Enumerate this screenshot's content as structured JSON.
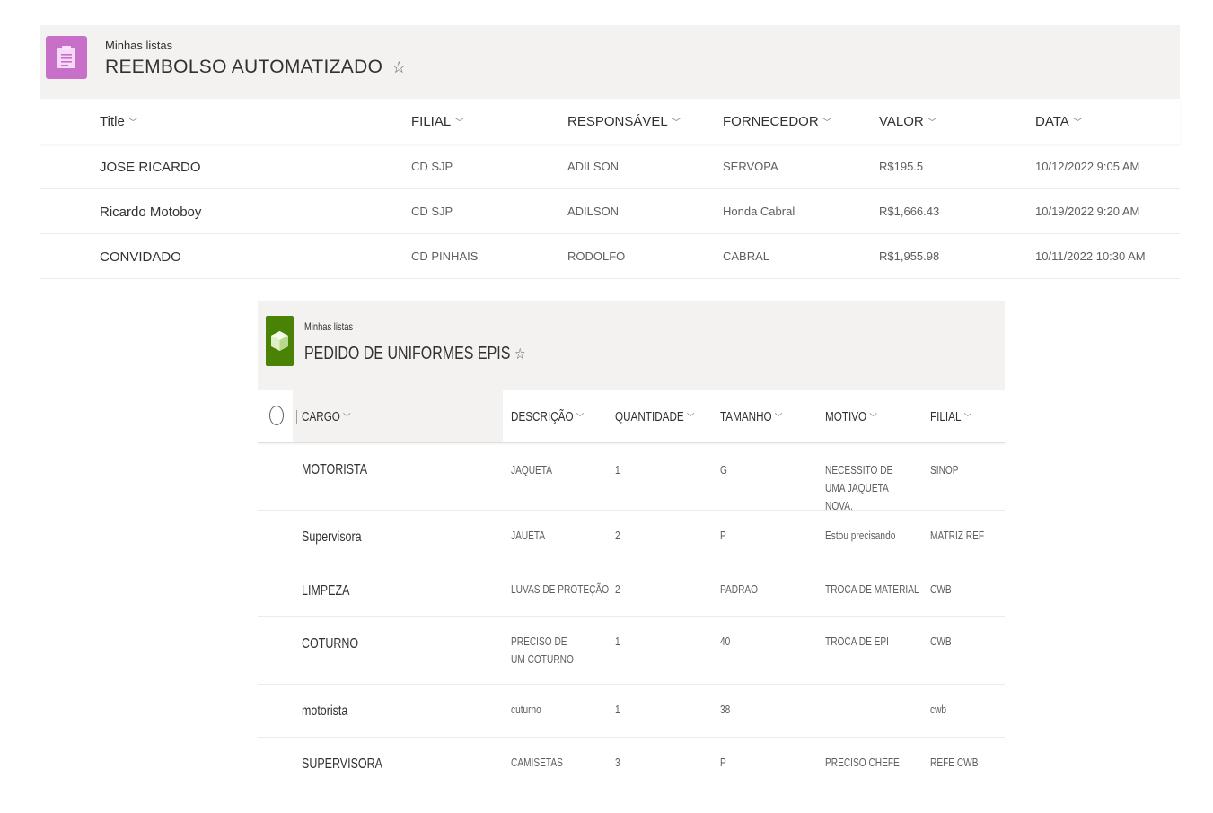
{
  "list1": {
    "breadcrumb": "Minhas listas",
    "title": "REEMBOLSO AUTOMATIZADO",
    "star": "☆",
    "icon_color": "#c86fc9",
    "columns": [
      "Title",
      "FILIAL",
      "RESPONSÁVEL",
      "FORNECEDOR",
      "VALOR",
      "DATA"
    ],
    "rows": [
      [
        "JOSE RICARDO",
        "CD SJP",
        "ADILSON",
        "SERVOPA",
        "R$195.5",
        "10/12/2022 9:05 AM"
      ],
      [
        "Ricardo Motoboy",
        "CD SJP",
        "ADILSON",
        "Honda Cabral",
        "R$1,666.43",
        "10/19/2022 9:20 AM"
      ],
      [
        "CONVIDADO",
        "CD PINHAIS",
        "RODOLFO",
        "CABRAL",
        "R$1,955.98",
        "10/11/2022 10:30 AM"
      ]
    ]
  },
  "list2": {
    "breadcrumb": "Minhas listas",
    "title": "PEDIDO DE UNIFORMES EPIS",
    "star": "☆",
    "icon_color": "#498205",
    "columns": [
      "CARGO",
      "DESCRIÇÃO",
      "QUANTIDADE",
      "TAMANHO",
      "MOTIVO",
      "FILIAL"
    ],
    "rows": [
      [
        "MOTORISTA",
        "JAQUETA",
        "1",
        "G",
        "NECESSITO DE UMA JAQUETA NOVA.",
        "SINOP"
      ],
      [
        "Supervisora",
        "JAUETA",
        "2",
        "P",
        "Estou precisando",
        "MATRIZ REF"
      ],
      [
        "LIMPEZA",
        "LUVAS DE PROTEÇÃO",
        "2",
        "PADRAO",
        "TROCA DE MATERIAL",
        "CWB"
      ],
      [
        "COTURNO",
        "PRECISO DE UM COTURNO",
        "1",
        "40",
        "TROCA DE EPI",
        "CWB"
      ],
      [
        "motorista",
        "cuturno",
        "1",
        "38",
        "",
        "cwb"
      ],
      [
        "SUPERVISORA",
        "CAMISETAS",
        "3",
        "P",
        "PRECISO CHEFE",
        "REFE CWB"
      ]
    ]
  },
  "chevron": "﹀"
}
